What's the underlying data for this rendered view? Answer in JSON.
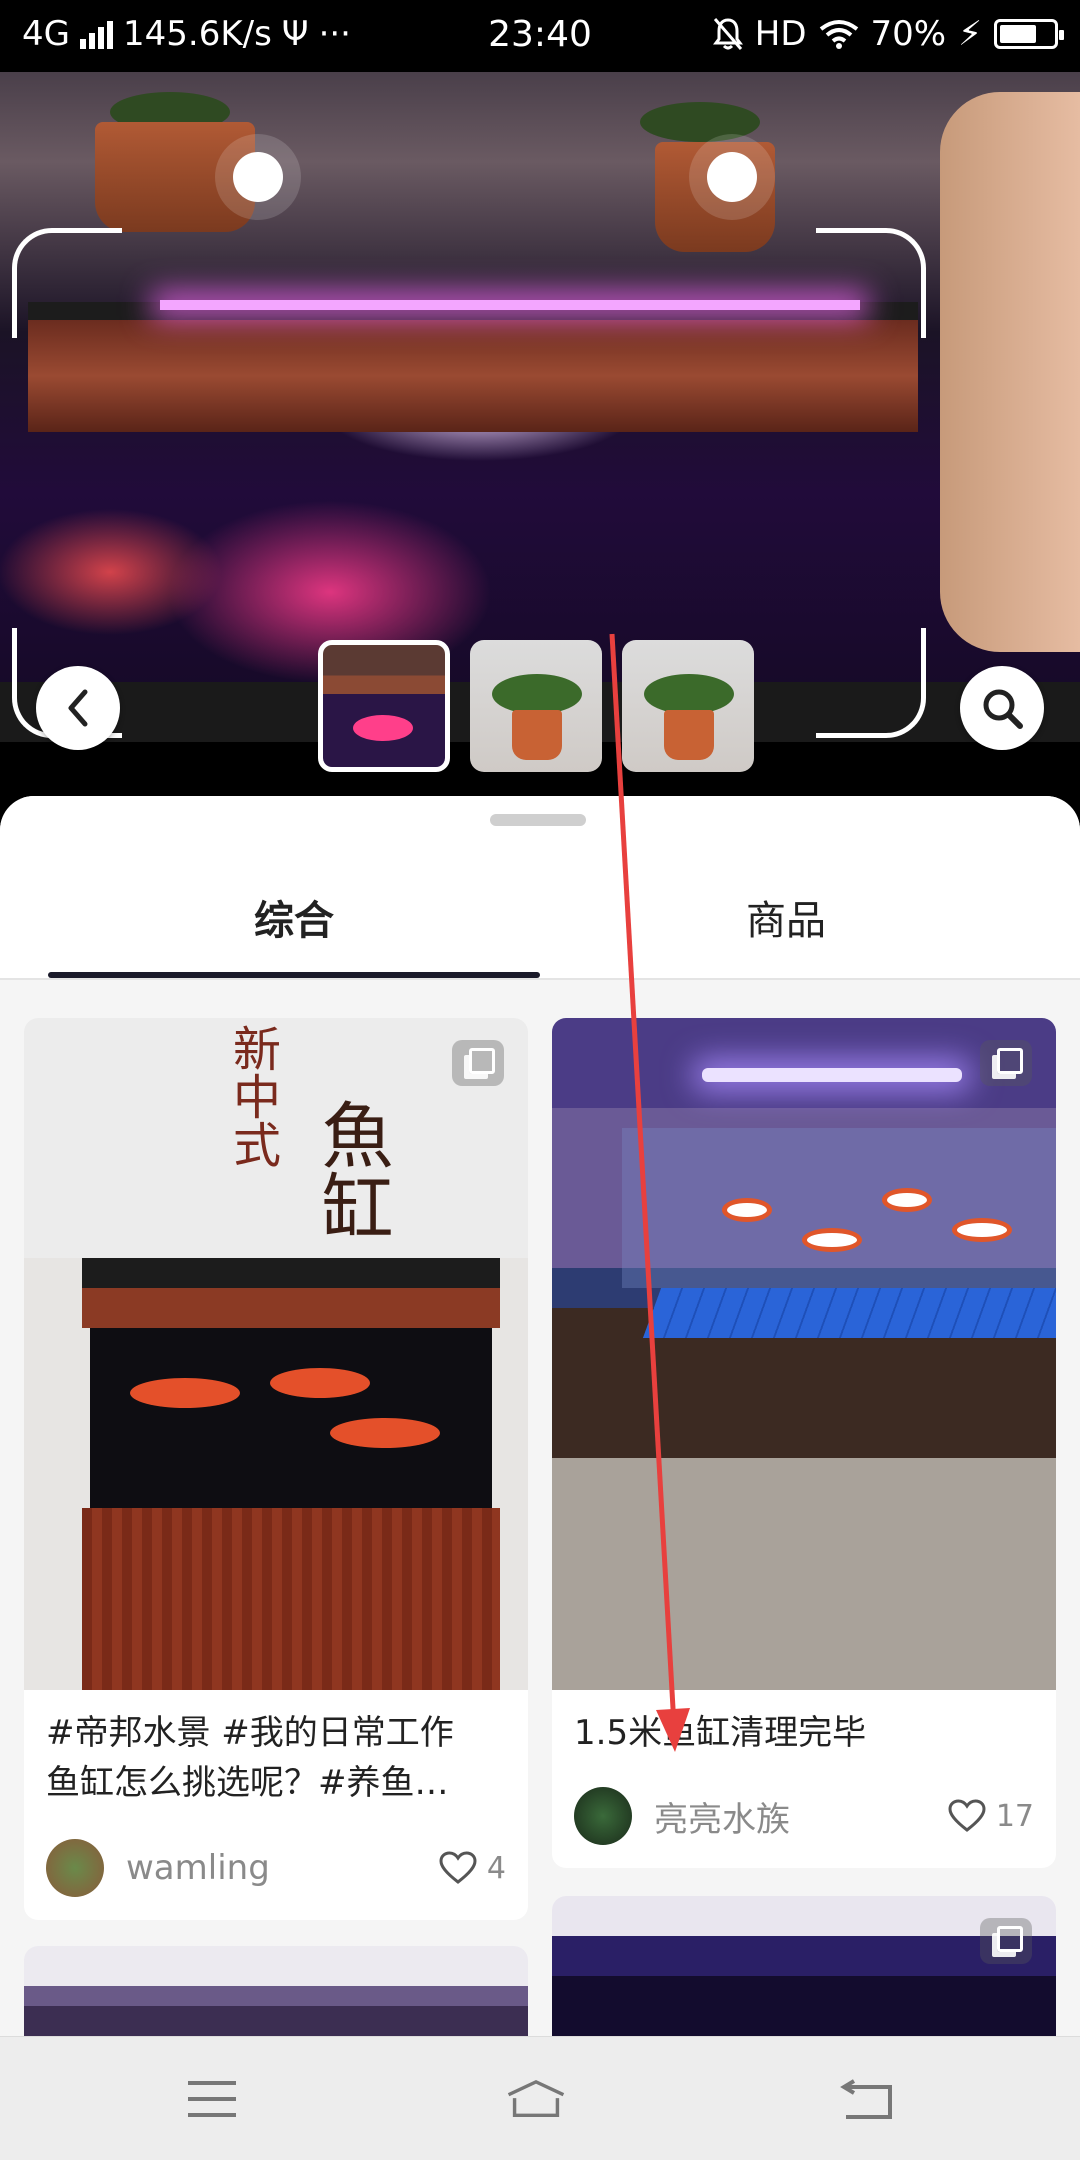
{
  "status_bar": {
    "network": "4G",
    "speed": "145.6K/s",
    "usb": "Ψ",
    "more": "···",
    "time": "23:40",
    "hd": "HD",
    "battery": "70%",
    "charging": "⚡",
    "battery_level": 0.7
  },
  "photo": {
    "thumbnails": [
      {
        "name": "fish-tank-crop",
        "selected": true
      },
      {
        "name": "potted-plant-1",
        "selected": false
      },
      {
        "name": "potted-plant-2",
        "selected": false
      }
    ]
  },
  "tabs": [
    {
      "label": "综合",
      "active": true
    },
    {
      "label": "商品",
      "active": false
    }
  ],
  "cards": [
    {
      "image_text": {
        "calligraphy": "新中式",
        "big": "魚缸"
      },
      "title": "#帝邦水景 #我的日常工作\n鱼缸怎么挑选呢？#养鱼…",
      "author": "wamling",
      "likes": "4"
    },
    {
      "title": "1.5米鱼缸清理完毕",
      "author": "亮亮水族",
      "likes": "17"
    }
  ],
  "colors": {
    "accent": "#1a1a2a",
    "gesture_arrow": "#e8403e",
    "sheet_bg": "#f5f5f5"
  },
  "icons": {
    "back": "chevron-left-icon",
    "search": "search-icon",
    "heart": "heart-icon",
    "multi_image": "copy-icon",
    "nav_menu": "menu-icon",
    "nav_home": "home-icon",
    "nav_back": "back-icon"
  }
}
